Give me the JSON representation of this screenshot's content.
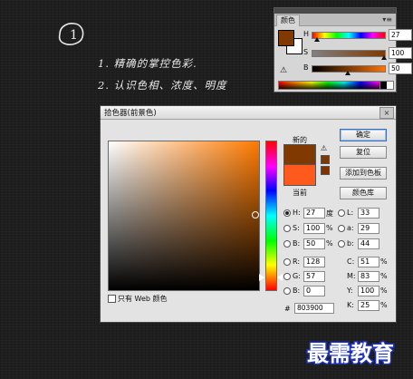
{
  "notes": {
    "step_number": "1",
    "line1": "1. 精确的掌控色彩.",
    "line2": "2. 认识色相、浓度、明度"
  },
  "color_panel": {
    "tab_label": "颜色",
    "sliders": [
      {
        "label": "H",
        "value": "27",
        "unit": "°",
        "level": 0.075
      },
      {
        "label": "S",
        "value": "100",
        "unit": "%",
        "level": 1.0
      },
      {
        "label": "B",
        "value": "50",
        "unit": "%",
        "level": 0.5
      }
    ],
    "foreground_color": "#803900",
    "background_color": "#ffffff"
  },
  "dialog": {
    "title": "拾色器(前景色)",
    "close_label": "×",
    "new_label": "新的",
    "current_label": "当前",
    "new_color": "#803900",
    "current_color": "#ff5a1e",
    "buttons": {
      "ok": "确定",
      "reset": "复位",
      "add_swatch": "添加到色板",
      "libraries": "颜色库"
    },
    "fields_left": [
      {
        "label": "H:",
        "value": "27",
        "unit": "度",
        "selected": true
      },
      {
        "label": "S:",
        "value": "100",
        "unit": "%",
        "selected": false
      },
      {
        "label": "B:",
        "value": "50",
        "unit": "%",
        "selected": false
      },
      {
        "label": "R:",
        "value": "128",
        "unit": "",
        "selected": false
      },
      {
        "label": "G:",
        "value": "57",
        "unit": "",
        "selected": false
      },
      {
        "label": "B:",
        "value": "0",
        "unit": "",
        "selected": false
      }
    ],
    "fields_lab": [
      {
        "label": "L:",
        "value": "33"
      },
      {
        "label": "a:",
        "value": "29"
      },
      {
        "label": "b:",
        "value": "44"
      }
    ],
    "fields_cmyk": [
      {
        "label": "C:",
        "value": "51",
        "unit": "%"
      },
      {
        "label": "M:",
        "value": "83",
        "unit": "%"
      },
      {
        "label": "Y:",
        "value": "100",
        "unit": "%"
      },
      {
        "label": "K:",
        "value": "25",
        "unit": "%"
      }
    ],
    "only_web_label": "只有 Web 颜色",
    "hex_label": "#",
    "hex_value": "803900"
  },
  "watermark": "最需教育"
}
